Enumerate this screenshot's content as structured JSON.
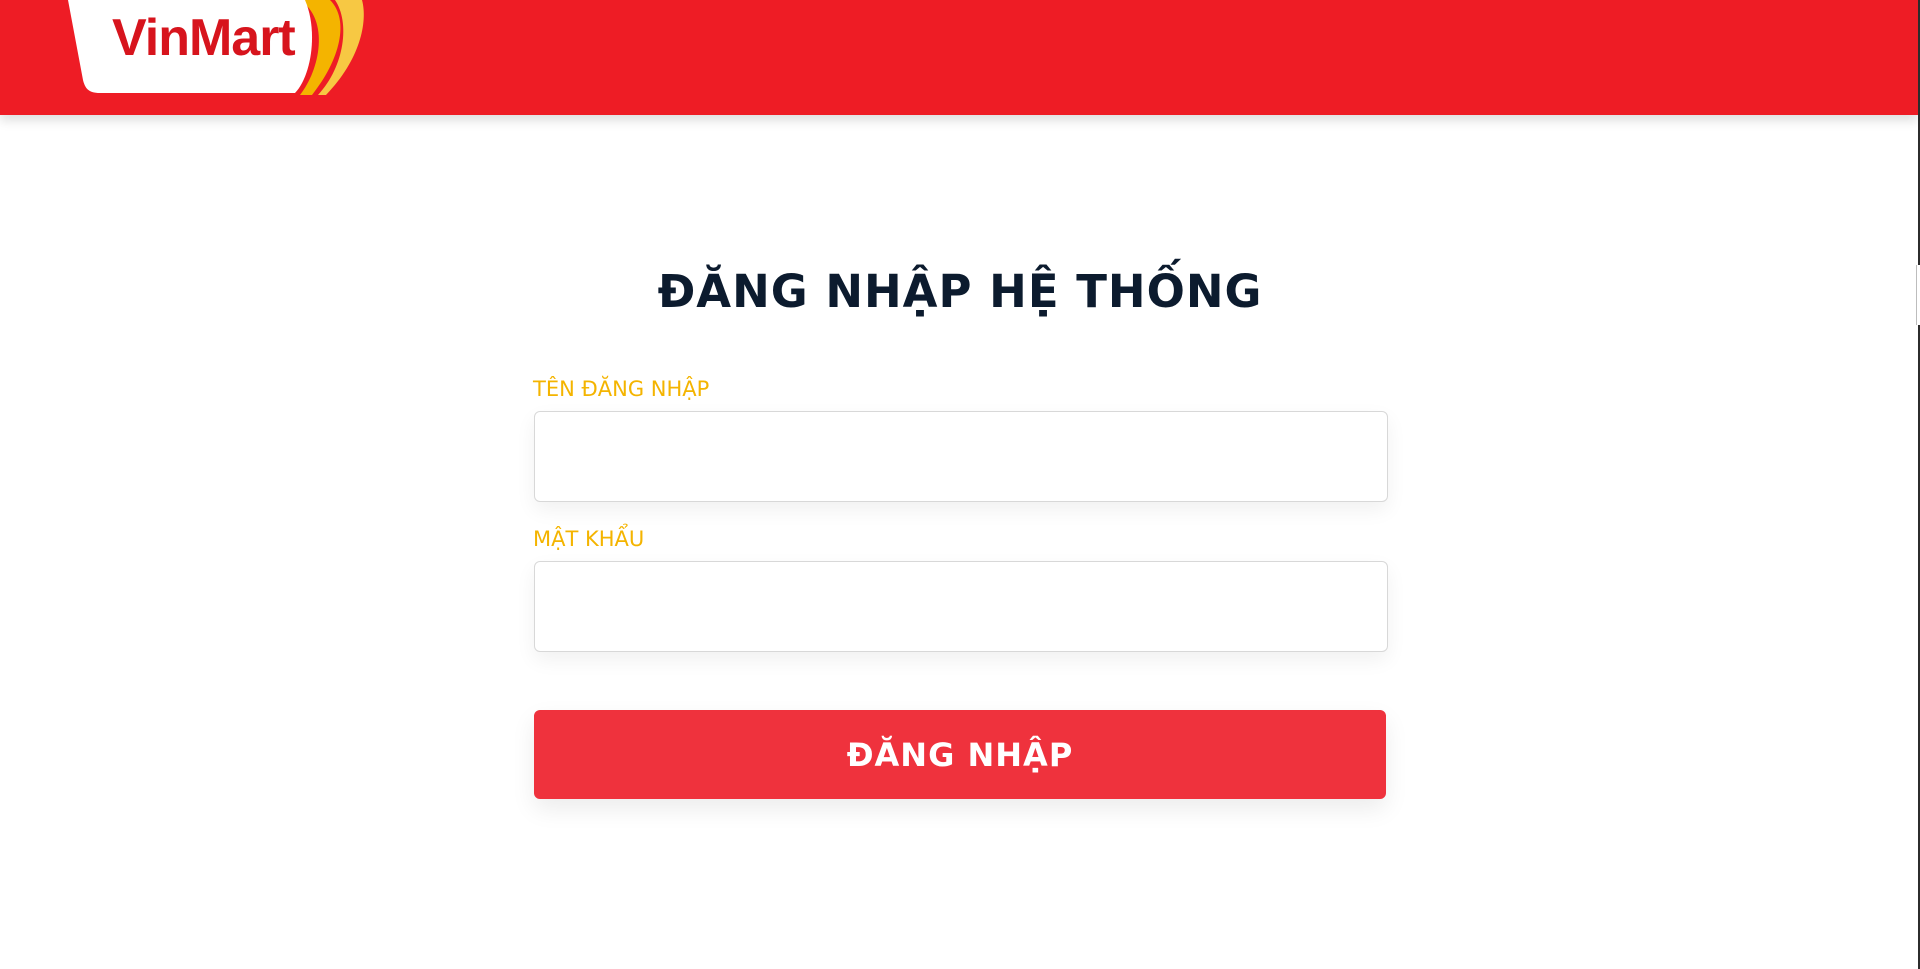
{
  "header": {
    "brand": "VinMart",
    "background_color": "#ee1c25"
  },
  "login": {
    "title": "ĐĂNG NHẬP HỆ THỐNG",
    "username_label": "TÊN ĐĂNG NHẬP",
    "username_value": "",
    "password_label": "MẬT KHẨU",
    "password_value": "",
    "submit_label": "ĐĂNG NHẬP",
    "label_color": "#f4b400",
    "button_color": "#ef323d"
  }
}
